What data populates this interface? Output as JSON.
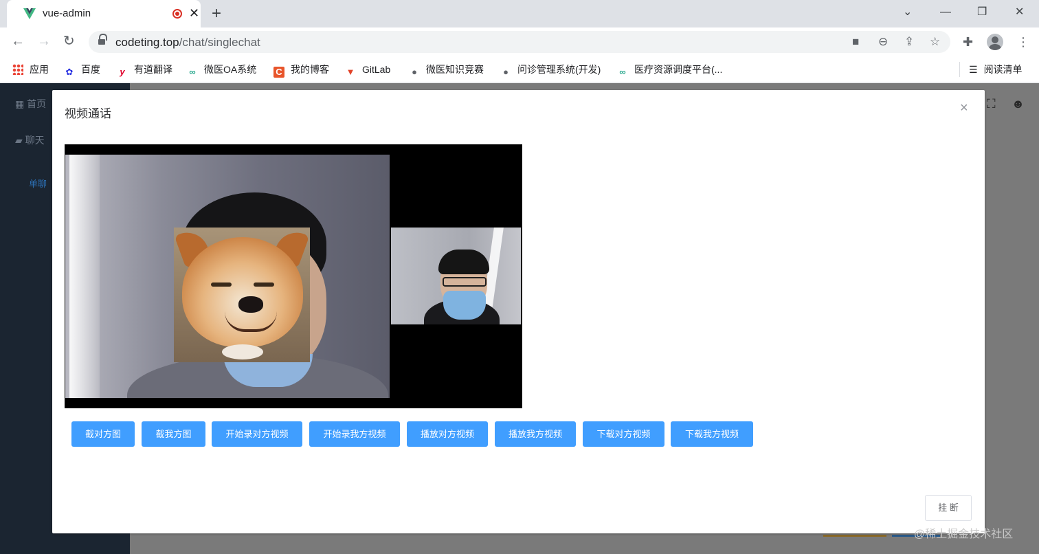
{
  "browser": {
    "tab_title": "vue-admin",
    "new_tab_glyph": "+",
    "url_host": "codeting.top",
    "url_path": "/chat/singlechat",
    "bookmarks": [
      {
        "label": "应用",
        "icon": "apps-grid-icon"
      },
      {
        "label": "百度",
        "icon": "baidu-icon"
      },
      {
        "label": "有道翻译",
        "icon": "youdao-icon"
      },
      {
        "label": "微医OA系统",
        "icon": "weiyi-icon"
      },
      {
        "label": "我的博客",
        "icon": "csdn-icon"
      },
      {
        "label": "GitLab",
        "icon": "gitlab-icon"
      },
      {
        "label": "微医知识竞赛",
        "icon": "globe-icon"
      },
      {
        "label": "问诊管理系统(开发)",
        "icon": "globe-icon"
      },
      {
        "label": "医疗资源调度平台(...",
        "icon": "weiyi-icon"
      }
    ],
    "reading_list": "阅读清单"
  },
  "app": {
    "sidebar": {
      "items": [
        {
          "label": "首页",
          "icon": "grid-icon"
        },
        {
          "label": "聊天",
          "icon": "chat-icon"
        }
      ],
      "sub_item": "单聊"
    }
  },
  "modal": {
    "title": "视频通话",
    "close_glyph": "×",
    "buttons": [
      "截对方图",
      "截我方图",
      "开始录对方视频",
      "开始录我方视频",
      "播放对方视频",
      "播放我方视频",
      "下载对方视频",
      "下载我方视频"
    ],
    "hangup_label": "挂 断"
  },
  "watermark": "@稀土掘金技术社区",
  "colors": {
    "primary": "#409eff",
    "sidebar": "#1b2531",
    "overlay": "#7a7a7a"
  }
}
